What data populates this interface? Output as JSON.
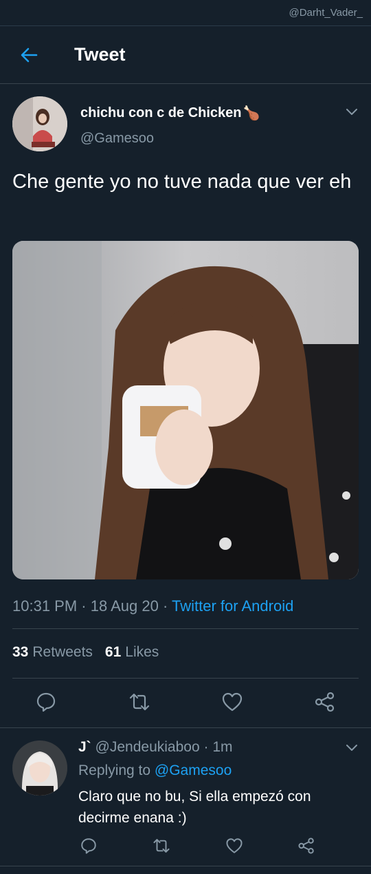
{
  "watermark": "@Darht_Vader_",
  "header": {
    "title": "Tweet"
  },
  "tweet": {
    "display_name": "chichu con c de Chicken",
    "name_emoji": "🍗",
    "handle": "@Gamesoo",
    "text": "Che gente yo no tuve nada que ver eh",
    "time": "10:31 PM",
    "date": "18 Aug 20",
    "separator": "·",
    "source": "Twitter for Android",
    "retweets_count": "33",
    "retweets_label": "Retweets",
    "likes_count": "61",
    "likes_label": "Likes"
  },
  "reply": {
    "name": "J`",
    "handle": "@Jendeukiaboo",
    "separator": "·",
    "time": "1m",
    "replying_prefix": "Replying to",
    "replying_to": "@Gamesoo",
    "text": "Claro que no bu, Si ella empezó con decirme enana :)"
  },
  "colors": {
    "background": "#15202b",
    "accent": "#1da1f2",
    "secondary_text": "#8899a6",
    "divider": "#38444d"
  },
  "icons": [
    "back-arrow-icon",
    "chevron-down-icon",
    "reply-icon",
    "retweet-icon",
    "like-icon",
    "share-icon"
  ]
}
